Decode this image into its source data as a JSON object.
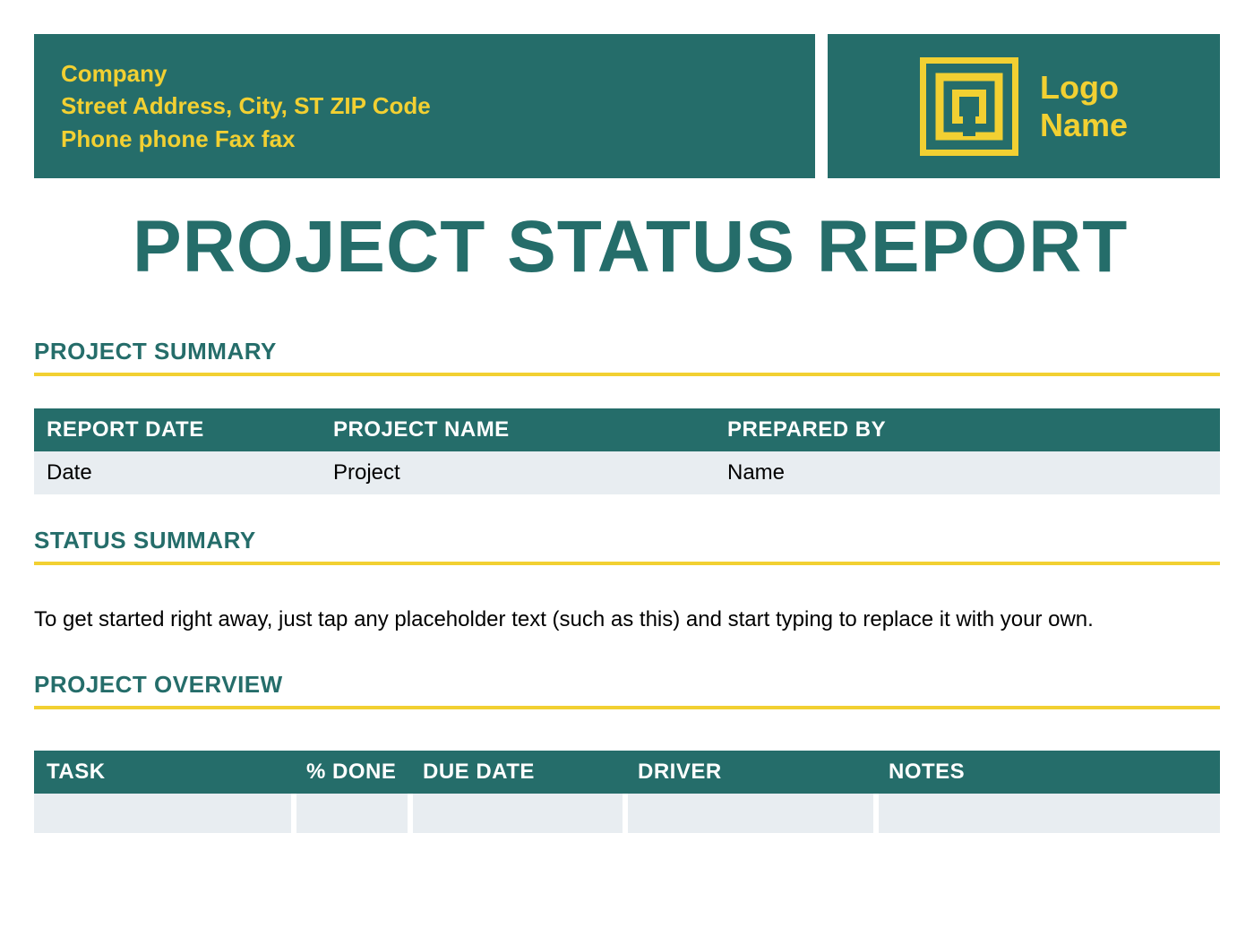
{
  "header": {
    "company_line": "Company",
    "address_line": "Street Address, City, ST ZIP Code",
    "contact_line": "Phone phone  Fax fax",
    "logo_line1": "Logo",
    "logo_line2": "Name"
  },
  "title": "PROJECT STATUS REPORT",
  "sections": {
    "project_summary": {
      "heading": "PROJECT SUMMARY",
      "columns": {
        "report_date": "REPORT DATE",
        "project_name": "PROJECT NAME",
        "prepared_by": "PREPARED BY"
      },
      "values": {
        "report_date": "Date",
        "project_name": "Project",
        "prepared_by": "Name"
      }
    },
    "status_summary": {
      "heading": "STATUS SUMMARY",
      "body": "To get started right away, just tap any placeholder text (such as this) and start typing to replace it with your own."
    },
    "project_overview": {
      "heading": "PROJECT OVERVIEW",
      "columns": {
        "task": "TASK",
        "pct_done": "% DONE",
        "due_date": "DUE DATE",
        "driver": "DRIVER",
        "notes": "NOTES"
      }
    }
  },
  "colors": {
    "teal": "#256d6a",
    "yellow": "#f2d032",
    "row_bg": "#e8edf1"
  }
}
